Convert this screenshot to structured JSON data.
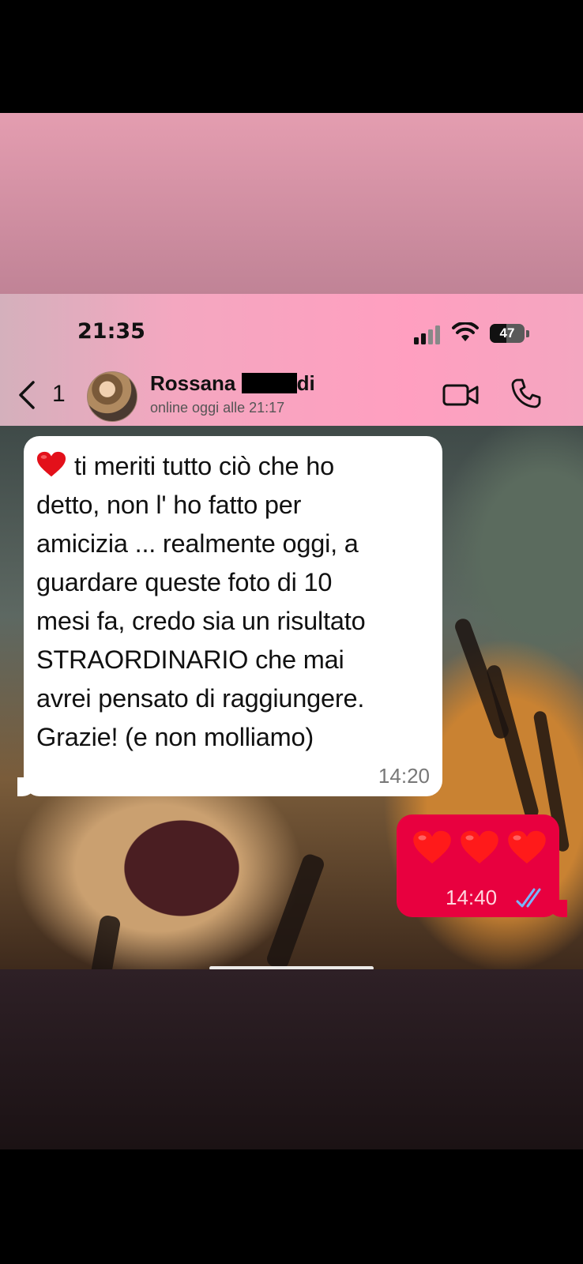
{
  "status_bar": {
    "time": "21:35",
    "battery": "47",
    "battery_level": 0.47
  },
  "header": {
    "back_count": "1",
    "contact_name_start": "Rossana",
    "contact_name_end": "di",
    "status": "online oggi alle 21:17",
    "icons": [
      "chevron-left-icon",
      "video-call-icon",
      "phone-icon"
    ]
  },
  "messages": [
    {
      "direction": "incoming",
      "emoji": "heart",
      "text": "ti meriti tutto ciò che ho\ndetto, non l' ho fatto per\namicizia ... realmente oggi, a\nguardare queste foto di 10\nmesi fa, credo sia un risultato\nSTRAORDINARIO che mai\navrei pensato di raggiungere.\nGrazie!  (e non molliamo)",
      "time": "14:20"
    },
    {
      "direction": "outgoing",
      "emoji": "heart",
      "emoji_count": 3,
      "time": "14:40",
      "read_status": "double-check-icon"
    }
  ],
  "colors": {
    "banner": "#d48ea4",
    "header": "#ff9fc0",
    "outgoing_bubble": "#e8003f",
    "incoming_bubble": "#ffffff",
    "read_ticks": "#7ab6ff"
  }
}
